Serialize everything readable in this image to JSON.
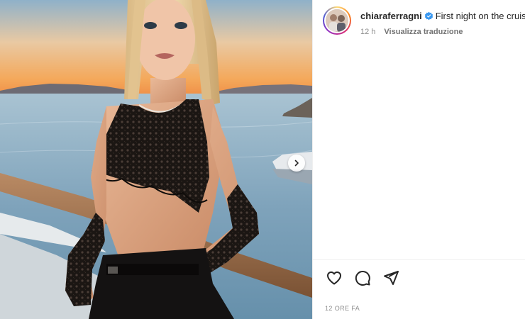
{
  "post": {
    "username": "chiaraferragni",
    "verified": true,
    "caption_text": "First night on the cruise",
    "caption_time": "12 h",
    "translate_label": "Visualizza traduzione",
    "posted_ago": "12 ORE FA"
  },
  "media": {
    "image_semantic": "photo-post",
    "next_icon": "chevron-right-icon"
  },
  "actions": {
    "like_icon": "heart-icon",
    "comment_icon": "comment-icon",
    "share_icon": "share-icon"
  },
  "colors": {
    "verified_blue": "#3897f0",
    "text_primary": "#262626",
    "text_secondary": "#8e8e8e",
    "divider": "#efefef"
  }
}
